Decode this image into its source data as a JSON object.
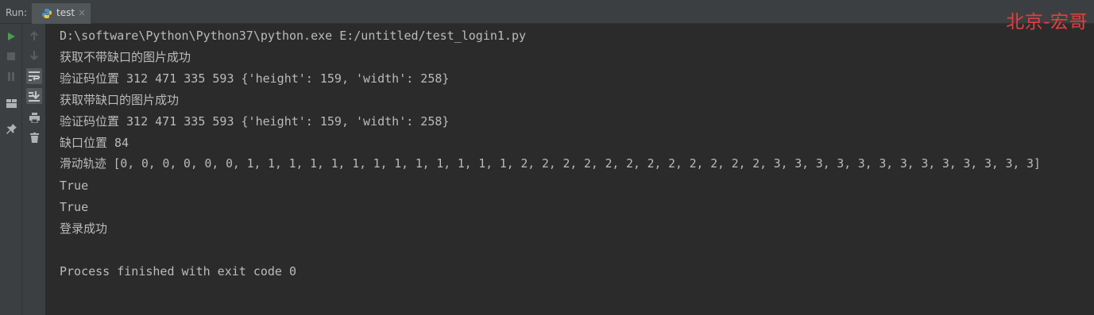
{
  "toolbar": {
    "run_label": "Run:",
    "tab_label": "test",
    "close_glyph": "×"
  },
  "watermark": "北京-宏哥",
  "left_toolbar": [
    {
      "name": "rerun-icon",
      "color": "#499c54"
    },
    {
      "name": "stop-icon",
      "color": "#6e6e6e"
    },
    {
      "name": "pause-icon",
      "color": "#6e6e6e"
    },
    {
      "name": "layout-icon",
      "color": "#afb1b3"
    },
    {
      "name": "pin-icon",
      "color": "#afb1b3"
    }
  ],
  "right_toolbar": [
    {
      "name": "up-arrow-icon"
    },
    {
      "name": "down-arrow-icon"
    },
    {
      "name": "soft-wrap-icon"
    },
    {
      "name": "scroll-to-end-icon"
    },
    {
      "name": "print-icon"
    },
    {
      "name": "trash-icon"
    }
  ],
  "console": {
    "lines": [
      "D:\\software\\Python\\Python37\\python.exe E:/untitled/test_login1.py",
      "获取不带缺口的图片成功",
      "验证码位置 312 471 335 593 {'height': 159, 'width': 258}",
      "获取带缺口的图片成功",
      "验证码位置 312 471 335 593 {'height': 159, 'width': 258}",
      "缺口位置 84",
      "滑动轨迹 [0, 0, 0, 0, 0, 0, 1, 1, 1, 1, 1, 1, 1, 1, 1, 1, 1, 1, 1, 2, 2, 2, 2, 2, 2, 2, 2, 2, 2, 2, 2, 3, 3, 3, 3, 3, 3, 3, 3, 3, 3, 3, 3, 3]",
      "True",
      "True",
      "登录成功",
      "",
      "Process finished with exit code 0"
    ]
  },
  "colors": {
    "background": "#2b2b2b",
    "panel": "#3c3f41",
    "console_text": "#bbbbbb",
    "watermark": "#e43f3f"
  }
}
